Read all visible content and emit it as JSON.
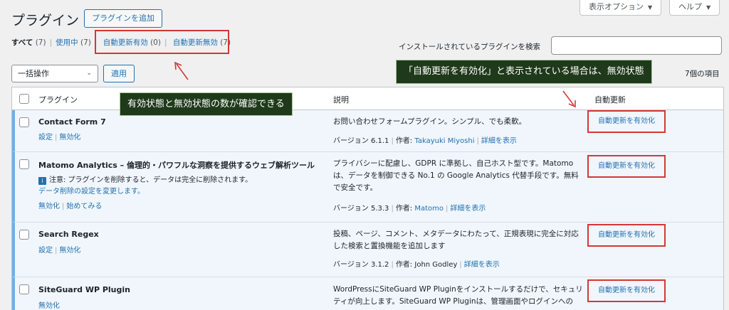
{
  "header": {
    "title": "プラグイン",
    "add_button": "プラグインを追加",
    "screen_options": "表示オプション",
    "help": "ヘルプ"
  },
  "filters": {
    "all": "すべて",
    "all_count": "(7)",
    "active": "使用中",
    "active_count": "(7)",
    "auto_on": "自動更新有効",
    "auto_on_count": "(0)",
    "auto_off": "自動更新無効",
    "auto_off_count": "(7)"
  },
  "search": {
    "label": "インストールされているプラグインを検索"
  },
  "bulk": {
    "select_value": "一括操作",
    "apply": "適用",
    "item_count": "7個の項目"
  },
  "table": {
    "col_plugin": "プラグイン",
    "col_desc": "説明",
    "col_auto": "自動更新",
    "rows": [
      {
        "name": "Contact Form 7",
        "actions": [
          "設定",
          "無効化"
        ],
        "desc": "お問い合わせフォームプラグイン。シンプル、でも柔軟。",
        "version": "バージョン 6.1.1",
        "author_label": "作者:",
        "author": "Takayuki Miyoshi",
        "details": "詳細を表示",
        "auto": "自動更新を有効化"
      },
      {
        "name": "Matomo Analytics – 倫理的・パワフルな洞察を提供するウェブ解析ツール",
        "notice": "注意: プラグインを削除すると、データは完全に削除されます。",
        "notice_link": "データ削除の設定を変更します。",
        "actions": [
          "無効化",
          "始めてみる"
        ],
        "desc": "プライバシーに配慮し、GDPR に準拠し、自己ホスト型です。Matomo は、データを制御できる No.1 の Google Analytics 代替手段です。無料で安全です。",
        "version": "バージョン 5.3.3",
        "author_label": "作者:",
        "author": "Matomo",
        "details": "詳細を表示",
        "auto": "自動更新を有効化"
      },
      {
        "name": "Search Regex",
        "actions": [
          "設定",
          "無効化"
        ],
        "desc": "投稿、ページ、コメント、メタデータにわたって、正規表現に完全に対応した検索と置換機能を追加します",
        "version": "バージョン 3.1.2",
        "author_label": "作者:",
        "author": "John Godley",
        "details": "詳細を表示",
        "auto": "自動更新を有効化"
      },
      {
        "name": "SiteGuard WP Plugin",
        "actions": [
          "無効化"
        ],
        "desc": "WordPressにSiteGuard WP Pluginをインストールするだけで、セキュリティが向上します。SiteGuard WP Pluginは、管理画面やログインへの",
        "auto": "自動更新を有効化"
      }
    ]
  },
  "annotations": {
    "counts": "有効状態と無効状態の数が確認できる",
    "auto_state": "「自動更新を有効化」と表示されている場合は、無効状態"
  },
  "colors": {
    "accent": "#2271b1",
    "annotation_red": "#d63638",
    "callout_bg": "#1f3a1a"
  }
}
